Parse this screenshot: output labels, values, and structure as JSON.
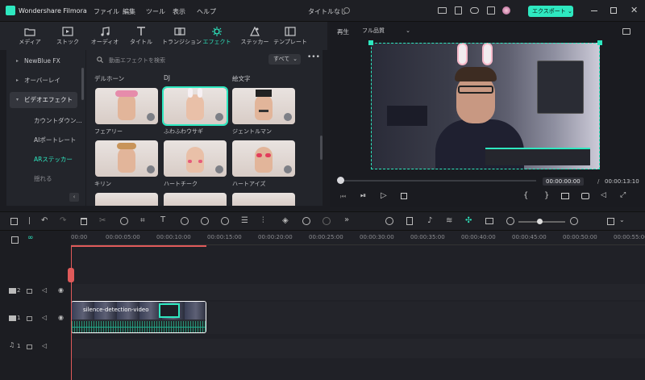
{
  "app": {
    "name": "Wondershare Filmora",
    "project_title": "タイトルなし"
  },
  "menu": [
    "ファイル",
    "編集",
    "ツール",
    "表示",
    "ヘルプ"
  ],
  "export_label": "エクスポート",
  "tabs": [
    {
      "label": "メディア",
      "icon": "media-icon"
    },
    {
      "label": "ストック",
      "icon": "stock-icon"
    },
    {
      "label": "オーディオ",
      "icon": "audio-icon"
    },
    {
      "label": "タイトル",
      "icon": "title-icon"
    },
    {
      "label": "トランジション",
      "icon": "transition-icon"
    },
    {
      "label": "エフェクト",
      "icon": "effects-icon",
      "active": true
    },
    {
      "label": "ステッカー",
      "icon": "sticker-icon"
    },
    {
      "label": "テンプレート",
      "icon": "template-icon"
    }
  ],
  "sidebar": {
    "items": [
      {
        "label": "NewBlue FX",
        "caret": "▸"
      },
      {
        "label": "オーバーレイ",
        "caret": "▸"
      },
      {
        "label": "ビデオエフェクト",
        "caret": "▾"
      },
      {
        "label": "カウントダウン..."
      },
      {
        "label": "AIポートレート"
      },
      {
        "label": "ARステッカー"
      },
      {
        "label": "揺れる"
      }
    ]
  },
  "search": {
    "placeholder": "動画エフェクトを検索",
    "filter": "すべて"
  },
  "effects": {
    "categories": [
      "デルホーン",
      "DJ",
      "絵文字"
    ],
    "row1": [
      "フェアリー",
      "ふわふわウサギ",
      "ジェントルマン"
    ],
    "row2": [
      "キリン",
      "ハートチーク",
      "ハートアイズ"
    ]
  },
  "preview": {
    "mode": "再生",
    "quality": "フル品質",
    "current_time": "00:00:00:00",
    "separator": "/",
    "total_time": "00:00:13:10"
  },
  "timeline": {
    "ruler": [
      "00:00",
      "00:00:05:00",
      "00:00:10:00",
      "00:00:15:00",
      "00:00:20:00",
      "00:00:25:00",
      "00:00:30:00",
      "00:00:35:00",
      "00:00:40:00",
      "00:00:45:00",
      "00:00:50:00",
      "00:00:55:00"
    ],
    "clip_name": "silence-detection-video",
    "tracks": [
      {
        "num": "2"
      },
      {
        "num": "1"
      },
      {
        "num": "1"
      }
    ]
  },
  "colors": {
    "accent": "#2ee8c0",
    "playhead": "#e05a5a",
    "bg": "#1b1c21"
  }
}
